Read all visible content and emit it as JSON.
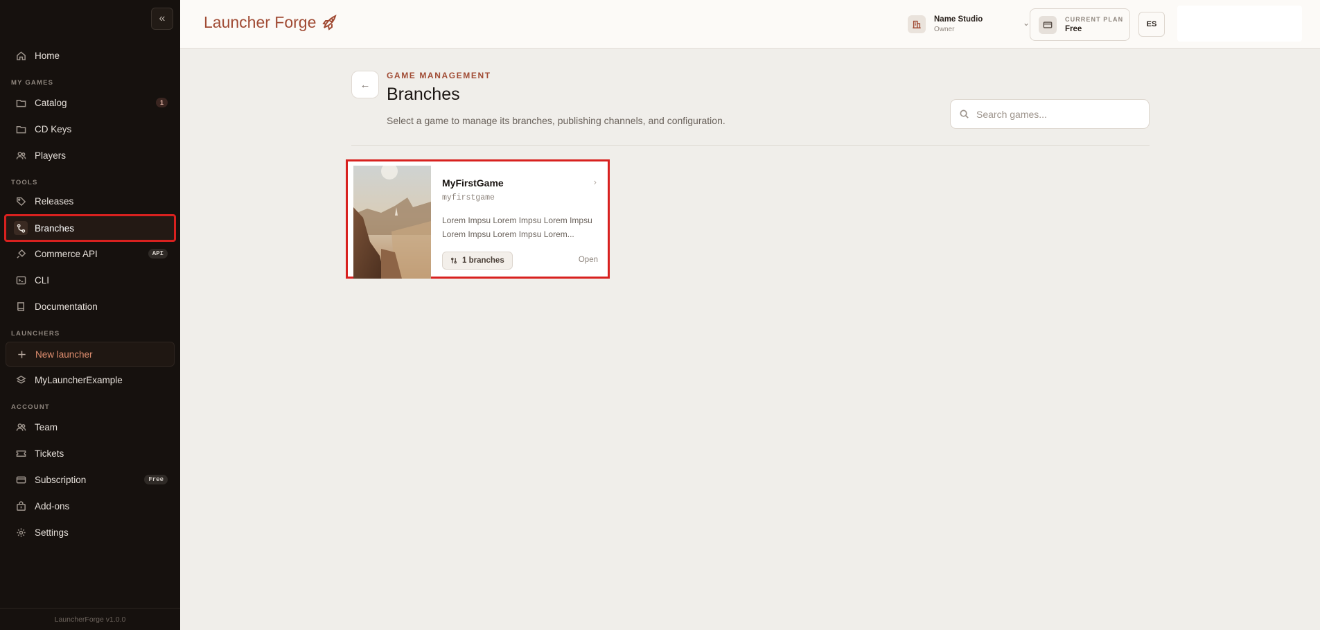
{
  "app": {
    "logo_text": "Launcher Forge",
    "version": "LauncherForge v1.0.0"
  },
  "sidebar": {
    "home": "Home",
    "sections": {
      "my_games": "MY GAMES",
      "tools": "TOOLS",
      "launchers": "LAUNCHERS",
      "account": "ACCOUNT"
    },
    "items": {
      "catalog": {
        "label": "Catalog",
        "badge": "1"
      },
      "cd_keys": {
        "label": "CD Keys"
      },
      "players": {
        "label": "Players"
      },
      "releases": {
        "label": "Releases"
      },
      "branches": {
        "label": "Branches"
      },
      "commerce_api": {
        "label": "Commerce API",
        "badge": "API"
      },
      "cli": {
        "label": "CLI"
      },
      "documentation": {
        "label": "Documentation"
      },
      "new_launcher": {
        "label": "New launcher"
      },
      "my_launcher": {
        "label": "MyLauncherExample"
      },
      "team": {
        "label": "Team"
      },
      "tickets": {
        "label": "Tickets"
      },
      "subscription": {
        "label": "Subscription",
        "badge": "Free"
      },
      "addons": {
        "label": "Add-ons"
      },
      "settings": {
        "label": "Settings"
      }
    }
  },
  "header": {
    "studio": {
      "name": "Name Studio",
      "role": "Owner"
    },
    "plan": {
      "label": "CURRENT PLAN",
      "value": "Free"
    },
    "language": "ES"
  },
  "main": {
    "eyebrow": "GAME MANAGEMENT",
    "title": "Branches",
    "description": "Select a game to manage its branches, publishing channels, and configuration.",
    "search_placeholder": "Search games..."
  },
  "games": [
    {
      "name": "MyFirstGame",
      "slug": "myfirstgame",
      "description": "Lorem Impsu Lorem Impsu Lorem Impsu Lorem Impsu Lorem Impsu Lorem...",
      "branches_label": "1 branches",
      "open_label": "Open"
    }
  ],
  "colors": {
    "accent": "#a04a33",
    "highlight": "#d8211f",
    "sidebar_bg": "#16110e"
  }
}
